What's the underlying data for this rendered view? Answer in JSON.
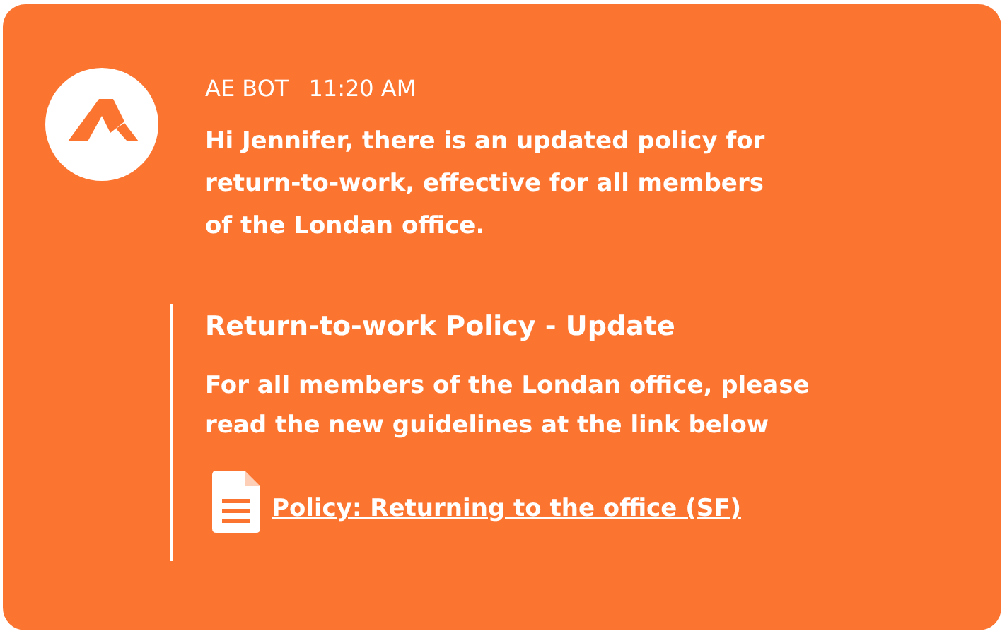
{
  "message": {
    "sender": "AE BOT",
    "time": "11:20 AM",
    "text": "Hi Jennifer, there is an updated policy for\nreturn-to-work, effective for all members\nof the Londan office.",
    "attachment": {
      "title": "Return-to-work Policy - Update",
      "body": "For all members of the Londan office, please\nread the new guidelines at the link below",
      "link": "Policy: Returning to the office (SF)"
    }
  }
}
